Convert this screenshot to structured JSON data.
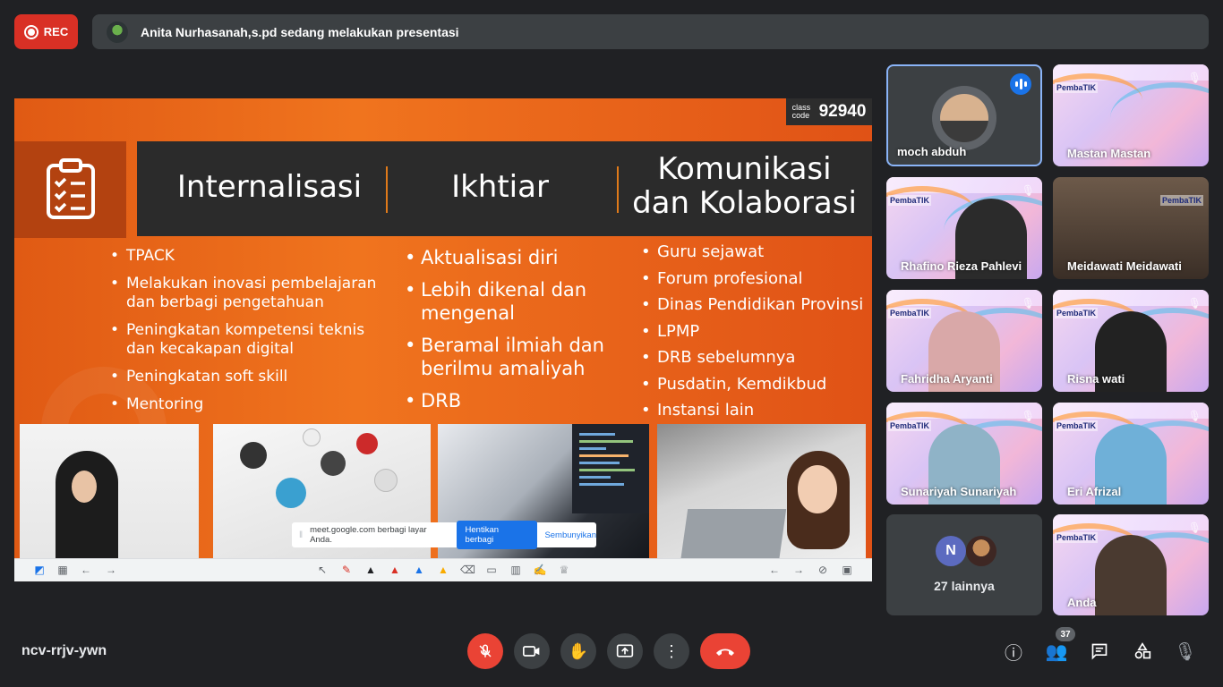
{
  "top": {
    "rec_label": "REC",
    "presenting_text": "Anita Nurhasanah,s.pd sedang melakukan presentasi"
  },
  "slide": {
    "class_code_label": "class code",
    "class_code_value": "92940",
    "headers": [
      "Internalisasi",
      "Ikhtiar",
      "Komunikasi dan Kolaborasi"
    ],
    "col1": [
      "TPACK",
      "Melakukan inovasi pembelajaran dan berbagi pengetahuan",
      "Peningkatan kompetensi teknis dan kecakapan digital",
      "Peningkatan soft skill",
      "Mentoring"
    ],
    "col2": [
      "Aktualisasi diri",
      "Lebih dikenal dan mengenal",
      "Beramal ilmiah dan berilmu amaliyah",
      "DRB"
    ],
    "col3": [
      "Guru sejawat",
      "Forum profesional",
      "Dinas Pendidikan Provinsi",
      "LPMP",
      "DRB sebelumnya",
      "Pusdatin, Kemdikbud",
      "Instansi lain"
    ]
  },
  "share_bar": {
    "text": "meet.google.com berbagi layar Anda.",
    "stop_label": "Hentikan berbagi",
    "hide_label": "Sembunyikan"
  },
  "participants": {
    "names": [
      "moch abduh",
      "Mastan Mastan",
      "Rhafino Rieza Pahlevi",
      "Meidawati Meidawati",
      "Fahridha Aryanti",
      "Risna wati",
      "Sunariyah Sunariyah",
      "Eri Afrizal",
      "Anda"
    ],
    "more_initial": "N",
    "more_label": "27 lainnya",
    "pemba_label": "PembaTIK"
  },
  "bottom": {
    "meeting_code": "ncv-rrjv-ywn",
    "people_count": "37"
  },
  "colors": {
    "accent": "#1a73e8",
    "danger": "#ea4335",
    "rec": "#d93025",
    "slide_orange": "#f0741e",
    "header_dark": "#2b2b2b"
  }
}
